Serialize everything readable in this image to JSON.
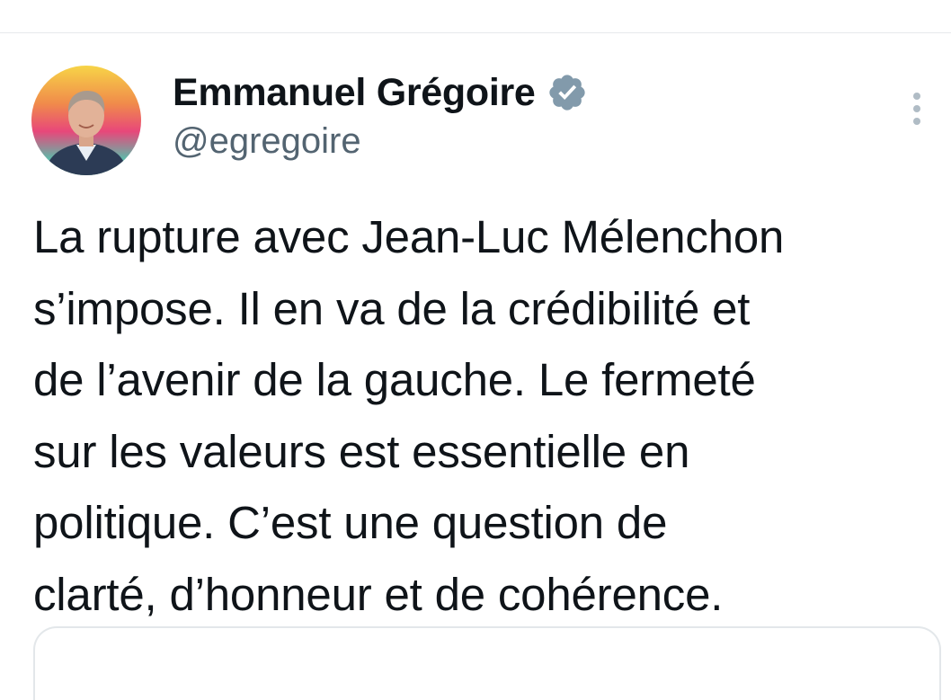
{
  "author": {
    "display_name": "Emmanuel Grégoire",
    "handle": "@egregoire",
    "verified": true
  },
  "icons": {
    "verified": "verified-badge-icon",
    "more": "more-vertical-icon"
  },
  "tweet": {
    "lines": [
      "La rupture avec Jean-Luc Mélenchon",
      "s’impose. Il en va de la crédibilité et",
      "de l’avenir de la gauche. Le fermeté",
      "sur les valeurs est essentielle en",
      "politique. C’est une question de",
      "clarté, d’honneur et de cohérence."
    ]
  },
  "colors": {
    "text_primary": "#0f1419",
    "text_secondary": "#536471",
    "verified_badge": "#829aab",
    "divider": "#e6e9ec"
  }
}
